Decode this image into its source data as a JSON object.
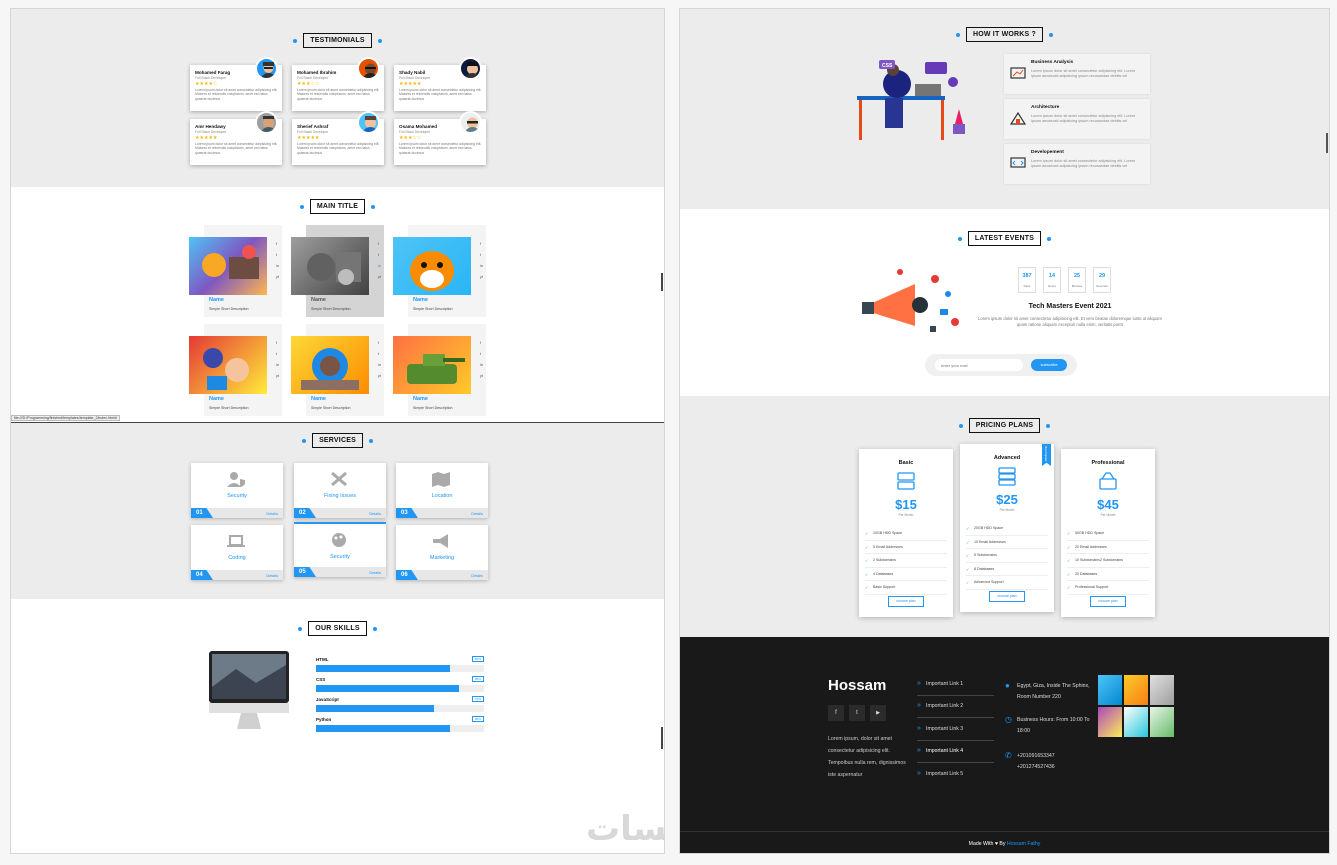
{
  "testimonials": {
    "title": "TESTIMONIALS",
    "items": [
      {
        "name": "Mohamed Farag",
        "role": "Full Stack Developer",
        "stars": "★★★★☆",
        "text": "Lorem ipsum dolor sit amet consectetur adipisicing elit. Maiores et reiciendis voluptatum, amet est natus quaerat ducimus"
      },
      {
        "name": "Mohamed Ibrahim",
        "role": "Full Stack Developer",
        "stars": "★★★☆☆",
        "text": "Lorem ipsum dolor sit amet consectetur adipisicing elit. Maiores et reiciendis voluptatum, amet est natus quaerat ducimus"
      },
      {
        "name": "Shady Nabil",
        "role": "Full Stack Developer",
        "stars": "★★★★★",
        "text": "Lorem ipsum dolor sit amet consectetur adipisicing elit. Maiores et reiciendis voluptatum, amet est natus quaerat ducimus"
      },
      {
        "name": "Amr Hendawy",
        "role": "Full Stack Developer",
        "stars": "★★★★★",
        "text": "Lorem ipsum dolor sit amet consectetur adipisicing elit. Maiores et reiciendis voluptatum, amet est natus quaerat ducimus"
      },
      {
        "name": "Sherief Ashraf",
        "role": "Full Stack Developer",
        "stars": "★★★★★",
        "text": "Lorem ipsum dolor sit amet consectetur adipisicing elit. Maiores et reiciendis voluptatum, amet est natus quaerat ducimus"
      },
      {
        "name": "Osama Mohamed",
        "role": "Full Stack Developer",
        "stars": "★★★☆☆",
        "text": "Lorem ipsum dolor sit amet consectetur adipisicing elit. Maiores et reiciendis voluptatum, amet est natus quaerat ducimus"
      }
    ]
  },
  "main_title": {
    "title": "MAIN TITLE",
    "cards": [
      {
        "name": "Name",
        "desc": "Simple Short Description"
      },
      {
        "name": "Name",
        "desc": "Simple Short Description"
      },
      {
        "name": "Name",
        "desc": "Simple Short Description"
      },
      {
        "name": "Name",
        "desc": "Simple Short Description"
      },
      {
        "name": "Name",
        "desc": "Simple Short Description"
      },
      {
        "name": "Name",
        "desc": "Simple Short Description"
      }
    ],
    "social": [
      "f",
      "t",
      "in",
      "yt"
    ]
  },
  "status_bar": {
    "url": "file:///D:/Programming/finished/templates/template_2/index.html#"
  },
  "services": {
    "title": "SERVICES",
    "details_label": "Details",
    "items": [
      {
        "label": "Security",
        "num": "01",
        "icon": "user-shield-icon"
      },
      {
        "label": "Fixing Issues",
        "num": "02",
        "icon": "tools-icon"
      },
      {
        "label": "Location",
        "num": "03",
        "icon": "map-icon"
      },
      {
        "label": "Coding",
        "num": "04",
        "icon": "laptop-code-icon"
      },
      {
        "label": "Security",
        "num": "05",
        "icon": "palette-icon"
      },
      {
        "label": "Marketing",
        "num": "06",
        "icon": "bullhorn-icon"
      }
    ]
  },
  "skills": {
    "title": "OUR SKILLS",
    "items": [
      {
        "name": "HTML",
        "percent": "80%",
        "value": 80
      },
      {
        "name": "CSS",
        "percent": "85%",
        "value": 85
      },
      {
        "name": "JavaScript",
        "percent": "70%",
        "value": 70
      },
      {
        "name": "Python",
        "percent": "80%",
        "value": 80
      }
    ]
  },
  "how": {
    "title": "HOW IT WORKS ?",
    "features": [
      {
        "title": "Business Analysis",
        "text": "Lorem ipsum dolor sit amet consectetur adipisicing elit. Lorem ipsum aecaecati adipisicing ipsum recusandae debitis vel"
      },
      {
        "title": "Architecture",
        "text": "Lorem ipsum dolor sit amet consectetur adipisicing elit. Lorem ipsum aecaecati adipisicing ipsum recusandae debitis vel"
      },
      {
        "title": "Developement",
        "text": "Lorem ipsum dolor sit amet consectetur adipisicing elit. Lorem ipsum aecaecati adipisicing ipsum recusandae debitis vel"
      }
    ],
    "illustration_label": "CSS"
  },
  "events": {
    "title": "LATEST EVENTS",
    "countdown": [
      {
        "value": "387",
        "unit": "Days"
      },
      {
        "value": "14",
        "unit": "Hours"
      },
      {
        "value": "25",
        "unit": "Minutes"
      },
      {
        "value": "29",
        "unit": "Seconds"
      }
    ],
    "event_title": "Tech Masters Event 2021",
    "event_text": "Lorem ipsum dolor sit amet consectetur adipisicing elit. Et vero beatae doloremque iusto ut aliquam quam ratione aliquam excepturi nulla enim, veritatis porro",
    "subscribe_placeholder": "enter your mail",
    "subscribe_button": "subscribe"
  },
  "pricing": {
    "title": "PRICING PLANS",
    "ribbon": "Most Popular",
    "plans": [
      {
        "name": "Basic",
        "price": "$15",
        "per": "Per Month",
        "features": [
          "10GB HDD Space",
          "5 Email Addresses",
          "2 Subdomains",
          "4 Databases",
          "Basic Support"
        ],
        "button": "choose plan"
      },
      {
        "name": "Advanced",
        "price": "$25",
        "per": "Per Month",
        "features": [
          "20GB HDD Space",
          "10 Email Addresses",
          "5 Subdomains",
          "8 Databases",
          "Advanced Support"
        ],
        "button": "choose plan"
      },
      {
        "name": "Professional",
        "price": "$45",
        "per": "Per Month",
        "features": [
          "50GB HDD Space",
          "20 Email Addresses",
          "10 Subdomains2 Subdomains",
          "20 Databases",
          "Professional Support"
        ],
        "button": "choose plan"
      }
    ]
  },
  "footer": {
    "brand": "Hossam",
    "about": "Lorem ipsum, dolor sit amet consectetur adipisicing elit. Tempoibus nulla rem, dignissimos iste aspernatur",
    "social": [
      "f",
      "t",
      "▶"
    ],
    "links": [
      "Important Link 1",
      "Important Link 2",
      "Important Link 3",
      "Important Link 4",
      "Important Link 5"
    ],
    "address_1": "Egypt, Giza, Inside The Sphinx,",
    "address_2": "Room Number 220",
    "hours_1": "Business Hours: From 10:00 To",
    "hours_2": "18:00",
    "phone_1": "+201091653347",
    "phone_2": "+201274527436",
    "made_with": "Made With ♥ By",
    "author": "Hossam Fathy"
  },
  "watermark": "خمسات",
  "colors": {
    "accent": "#2196f3",
    "dark": "#1a1a1a",
    "gray_bg": "#ececec"
  }
}
